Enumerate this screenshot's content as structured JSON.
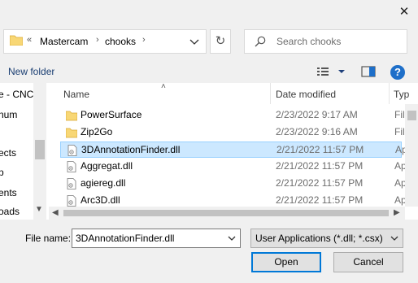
{
  "window": {
    "close_glyph": "✕"
  },
  "address": {
    "separator": "«",
    "crumbs": [
      "Mastercam",
      "chooks"
    ],
    "crumb_sep": "›",
    "folder_icon": "folder-icon",
    "dropdown_icon": "chevron-down-icon"
  },
  "refresh": {
    "glyph": "↻",
    "icon": "refresh-icon"
  },
  "search": {
    "placeholder": "Search chooks",
    "icon": "search-icon"
  },
  "toolbar": {
    "new_folder": "New folder",
    "view_icon": "view-options-icon",
    "preview_icon": "preview-pane-icon",
    "help_glyph": "?"
  },
  "nav": {
    "items": [
      "e - CNC",
      "num",
      "",
      "ects",
      "p",
      "ents",
      "oads"
    ]
  },
  "file_list": {
    "columns": [
      "Name",
      "Date modified",
      "Typ"
    ],
    "sort_glyph": "˄",
    "rows": [
      {
        "name": "PowerSurface",
        "date": "2/23/2022 9:17 AM",
        "type": "Fil",
        "kind": "folder",
        "selected": false
      },
      {
        "name": "Zip2Go",
        "date": "2/23/2022 9:16 AM",
        "type": "Fil",
        "kind": "folder",
        "selected": false
      },
      {
        "name": "3DAnnotationFinder.dll",
        "date": "2/21/2022 11:57 PM",
        "type": "Ap",
        "kind": "dll",
        "selected": true
      },
      {
        "name": "Aggregat.dll",
        "date": "2/21/2022 11:57 PM",
        "type": "Ap",
        "kind": "dll",
        "selected": false
      },
      {
        "name": "agiereg.dll",
        "date": "2/21/2022 11:57 PM",
        "type": "Ap",
        "kind": "dll",
        "selected": false
      },
      {
        "name": "Arc3D.dll",
        "date": "2/21/2022 11:57 PM",
        "type": "Ap",
        "kind": "dll",
        "selected": false
      }
    ]
  },
  "bottom": {
    "filename_label": "File name:",
    "filename_value": "3DAnnotationFinder.dll",
    "filetype_value": "User Applications (*.dll; *.csx)",
    "open_label": "Open",
    "cancel_label": "Cancel"
  },
  "colors": {
    "accent": "#0078d7",
    "selection": "#cce8ff",
    "folder": "#f8d775",
    "help": "#1e6fc9"
  }
}
